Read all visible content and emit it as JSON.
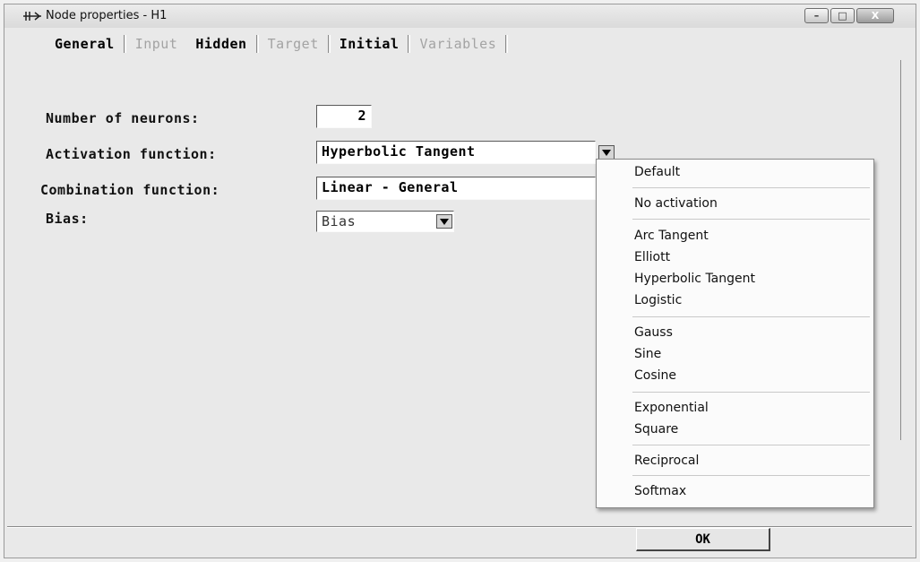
{
  "window": {
    "title": "Node properties - H1",
    "buttons": {
      "minimize": "–",
      "maximize": "□",
      "close": "X"
    }
  },
  "tabs": [
    {
      "label": "General",
      "enabled": true
    },
    {
      "label": "Input",
      "enabled": false
    },
    {
      "label": "Hidden",
      "enabled": true
    },
    {
      "label": "Target",
      "enabled": false
    },
    {
      "label": "Initial",
      "enabled": true
    },
    {
      "label": "Variables",
      "enabled": false
    }
  ],
  "form": {
    "neurons_label": "Number of neurons:",
    "neurons_value": "2",
    "activation_label": "Activation function:",
    "activation_value": "Hyperbolic Tangent",
    "combination_label": "Combination function:",
    "combination_value": "Linear - General",
    "bias_label": "Bias:",
    "bias_value": "Bias"
  },
  "activation_menu": [
    "Default",
    "No activation",
    "Arc Tangent",
    "Elliott",
    "Hyperbolic Tangent",
    "Logistic",
    "Gauss",
    "Sine",
    "Cosine",
    "Exponential",
    "Square",
    "Reciprocal",
    "Softmax"
  ],
  "ok_label": "OK"
}
